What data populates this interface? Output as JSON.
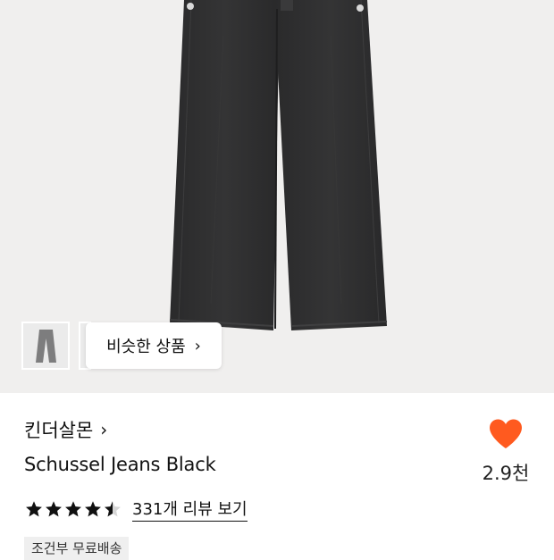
{
  "gallery": {
    "similar_button_label": "비슷한 상품",
    "similar_button_chevron": "›"
  },
  "product": {
    "brand": "킨더살몬",
    "brand_chevron": "›",
    "name": "Schussel Jeans Black",
    "rating": 4.5,
    "review_link_label": "331개 리뷰 보기",
    "shipping_badge": "조건부 무료배송"
  },
  "like": {
    "icon": "heart-icon",
    "count_label": "2.9천",
    "color": "#ff5a1f"
  },
  "colors": {
    "hero_background": "#f0efee",
    "denim": "#2e2e2f"
  }
}
